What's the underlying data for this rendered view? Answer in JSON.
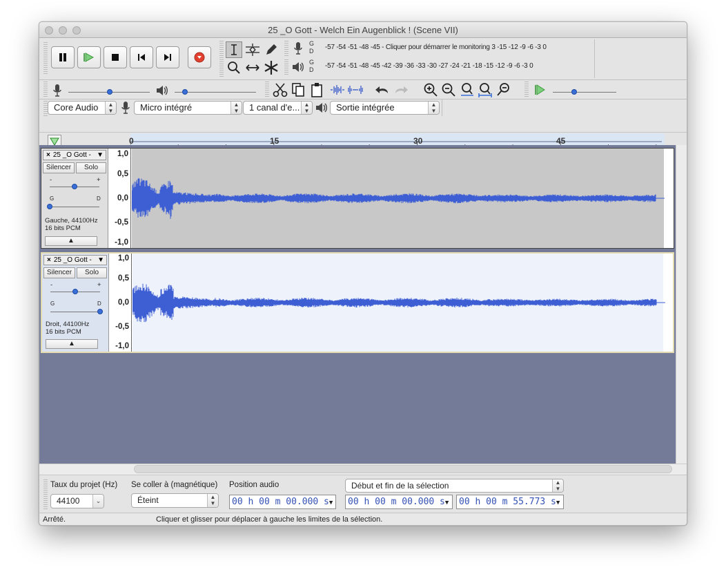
{
  "window": {
    "title": "25 _O Gott - Welch Ein Augenblick ! (Scene VII)"
  },
  "meters": {
    "record": {
      "channel_top": "G",
      "channel_bottom": "D",
      "scale_left": "-57 -54 -51 -48 -45 -",
      "prompt": "Cliquer pour démarrer le monitoring",
      "scale_right": "3 -15 -12 -9 -6 -3 0"
    },
    "playback": {
      "channel_top": "G",
      "channel_bottom": "D",
      "scale": "-57 -54 -51 -48 -45 -42 -39 -36 -33 -30 -27 -24 -21 -18 -15 -12 -9 -6 -3 0"
    }
  },
  "devices": {
    "host": "Core Audio",
    "input": "Micro intégré",
    "channels": "1 canal d'e...",
    "output": "Sortie intégrée"
  },
  "timeline": {
    "ticks": [
      "0",
      "15",
      "30",
      "45"
    ]
  },
  "tracks": [
    {
      "name": "25 _O Gott - ",
      "mute_label": "Silencer",
      "solo_label": "Solo",
      "gain_minus": "-",
      "gain_plus": "+",
      "pan_left": "G",
      "pan_right": "D",
      "info_line1": "Gauche, 44100Hz",
      "info_line2": "16 bits PCM",
      "scale": [
        "1,0",
        "0,5",
        "0,0",
        "-0,5",
        "-1,0"
      ],
      "selected": false
    },
    {
      "name": "25 _O Gott - ",
      "mute_label": "Silencer",
      "solo_label": "Solo",
      "gain_minus": "-",
      "gain_plus": "+",
      "pan_left": "G",
      "pan_right": "D",
      "info_line1": "Droit, 44100Hz",
      "info_line2": "16 bits PCM",
      "scale": [
        "1,0",
        "0,5",
        "0,0",
        "-0,5",
        "-1,0"
      ],
      "selected": true
    }
  ],
  "selection_toolbar": {
    "rate_label": "Taux du projet (Hz)",
    "rate_value": "44100",
    "snap_label": "Se coller à (magnétique)",
    "snap_value": "Éteint",
    "position_label": "Position audio",
    "position_value": "00 h 00 m 00.000 s",
    "selection_mode": "Début et fin de la sélection",
    "selection_start": "00 h 00 m 00.000 s",
    "selection_end": "00 h 00 m 55.773 s"
  },
  "status": {
    "state": "Arrêté.",
    "hint": "Cliquer et glisser pour déplacer à gauche les limites de la sélection."
  },
  "colors": {
    "waveform": "#3e5ed4",
    "track_bg": "#c8c8c8",
    "track_selected_bg": "#eef3fb",
    "empty_area": "#737b99",
    "timeline_bg": "#dbe6f4",
    "time_digits": "#3351b5"
  }
}
